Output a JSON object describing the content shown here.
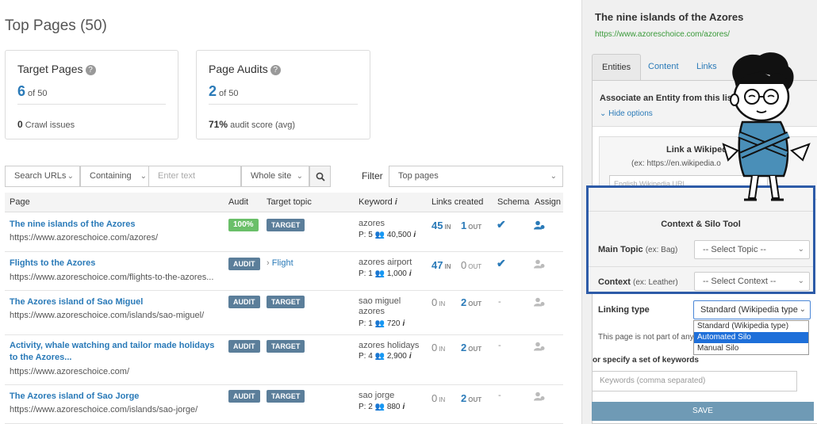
{
  "page_title": "Top Pages (50)",
  "cards": [
    {
      "title": "Target Pages",
      "big": "6",
      "of": "of 50",
      "foot_value": "0",
      "foot_text": "Crawl issues"
    },
    {
      "title": "Page Audits",
      "big": "2",
      "of": "of 50",
      "foot_value": "71%",
      "foot_text": "audit score (avg)"
    }
  ],
  "filters": {
    "search_select": "Search URLs",
    "match_select": "Containing",
    "text_placeholder": "Enter text",
    "scope_select": "Whole site",
    "filter_label": "Filter",
    "filter_select": "Top pages"
  },
  "table": {
    "headers": [
      "Page",
      "Audit",
      "Target topic",
      "Keyword",
      "Links created",
      "Schema",
      "Assign"
    ],
    "rows": [
      {
        "title": "The nine islands of the Azores",
        "url": "https://www.azoreschoice.com/azores/",
        "audit": "100%",
        "topic": "TARGET",
        "keyword": "azores",
        "kw_meta": "P: 5",
        "kw_volume": "40,500",
        "links_in": "45",
        "links_out": "1",
        "schema": true
      },
      {
        "title": "Flights to the Azores",
        "url": "https://www.azoreschoice.com/flights-to-the-azores...",
        "audit": "AUDIT",
        "topic": "Flight",
        "keyword": "azores airport",
        "kw_meta": "P: 1",
        "kw_volume": "1,000",
        "links_in": "47",
        "links_out": "0",
        "schema": true
      },
      {
        "title": "The Azores island of Sao Miguel",
        "url": "https://www.azoreschoice.com/islands/sao-miguel/",
        "audit": "AUDIT",
        "topic": "TARGET",
        "keyword_line1": "sao miguel",
        "keyword_line2": "azores",
        "kw_meta": "P: 1",
        "kw_volume": "720",
        "links_in": "0",
        "links_out": "2",
        "schema": "-"
      },
      {
        "title": "Activity, whale watching and tailor made holidays to the Azores...",
        "url": "https://www.azoreschoice.com/",
        "audit": "AUDIT",
        "topic": "TARGET",
        "keyword": "azores holidays",
        "kw_meta": "P: 4",
        "kw_volume": "2,900",
        "links_in": "0",
        "links_out": "2",
        "schema": "-"
      },
      {
        "title": "The Azores island of Sao Jorge",
        "url": "https://www.azoreschoice.com/islands/sao-jorge/",
        "audit": "AUDIT",
        "topic": "TARGET",
        "keyword": "sao jorge",
        "kw_meta": "P: 2",
        "kw_volume": "880",
        "links_in": "0",
        "links_out": "2",
        "schema": "-"
      }
    ],
    "in_label": "IN",
    "out_label": "OUT"
  },
  "panel": {
    "title": "The nine islands of the Azores",
    "url": "https://www.azoreschoice.com/azores/",
    "tabs": [
      "Entities",
      "Content",
      "Links &"
    ],
    "assoc_text": "Associate an Entity from this list to",
    "hide_options": "Hide options",
    "wiki_title": "Link a Wikipedia",
    "wiki_sub": "(ex: https://en.wikipedia.o",
    "wiki_placeholder": "English Wikipedia URL",
    "silo_title": "Context & Silo Tool",
    "main_topic_label": "Main Topic",
    "main_topic_hint": "(ex: Bag)",
    "main_topic_select": "-- Select Topic --",
    "context_label": "Context",
    "context_hint": "(ex: Leather)",
    "context_select": "-- Select Context --",
    "linking_label": "Linking type",
    "linking_select": "Standard (Wikipedia type)",
    "linking_options": [
      "Standard (Wikipedia type)",
      "Automated Silo",
      "Manual Silo"
    ],
    "not_part": "This page is not part of any",
    "specify": "or specify a set of keywords",
    "keywords_placeholder": "Keywords (comma separated)",
    "save": "SAVE"
  },
  "colors": {
    "link": "#2a7ab8",
    "badge_green": "#6abf69",
    "badge_slate": "#5b7e9a",
    "silo_border": "#2d5ba8",
    "save": "#6f9ab5"
  }
}
